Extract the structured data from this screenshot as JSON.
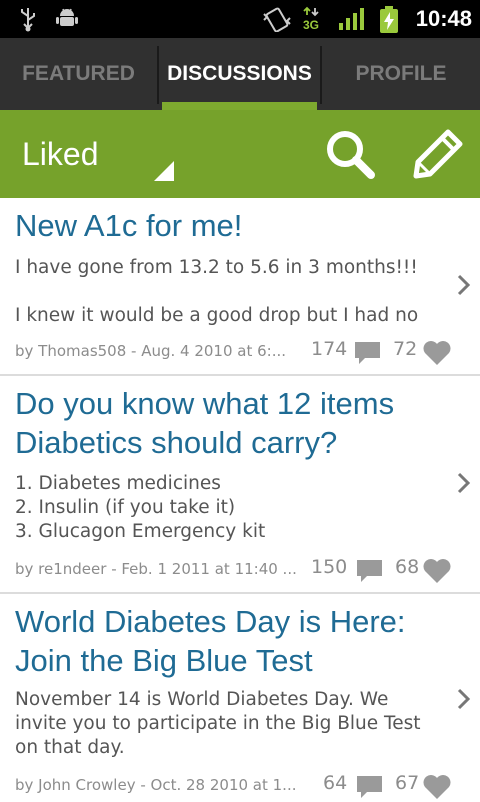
{
  "status_bar": {
    "time": "10:48",
    "network": "3G",
    "icons": [
      "usb-icon",
      "android-debug-icon",
      "vibrate-icon",
      "3g-data-icon",
      "signal-icon",
      "battery-charging-icon"
    ]
  },
  "tabs": [
    {
      "label": "FEATURED",
      "active": false
    },
    {
      "label": "DISCUSSIONS",
      "active": true
    },
    {
      "label": "PROFILE",
      "active": false
    }
  ],
  "action_bar": {
    "filter_label": "Liked",
    "icons": [
      "search-icon",
      "compose-icon"
    ]
  },
  "colors": {
    "accent_green": "#76a22b",
    "tab_bar": "#303030",
    "title_blue": "#1f6b94"
  },
  "posts": [
    {
      "title": "New A1c for me!",
      "body_lines": [
        "I have gone from 13.2 to 5.6 in 3 months!!!",
        "",
        "I knew it would be a good drop but I had no"
      ],
      "byline": "by Thomas508 - Aug. 4 2010 at 6:...",
      "comments": "174",
      "likes": "72"
    },
    {
      "title": "Do you know what 12 items Diabetics should carry?",
      "body_lines": [
        "1. Diabetes medicines",
        "2. Insulin (if you take it)",
        "3. Glucagon Emergency kit"
      ],
      "byline": "by re1ndeer - Feb. 1 2011 at 11:40 ...",
      "comments": "150",
      "likes": "68"
    },
    {
      "title": "World Diabetes Day is Here: Join the Big Blue Test",
      "body_lines": [
        "November 14 is World Diabetes Day. We",
        "invite you to participate in the Big Blue Test",
        "on that day."
      ],
      "byline": "by John Crowley - Oct. 28 2010 at 1...",
      "comments": "64",
      "likes": "67"
    }
  ]
}
